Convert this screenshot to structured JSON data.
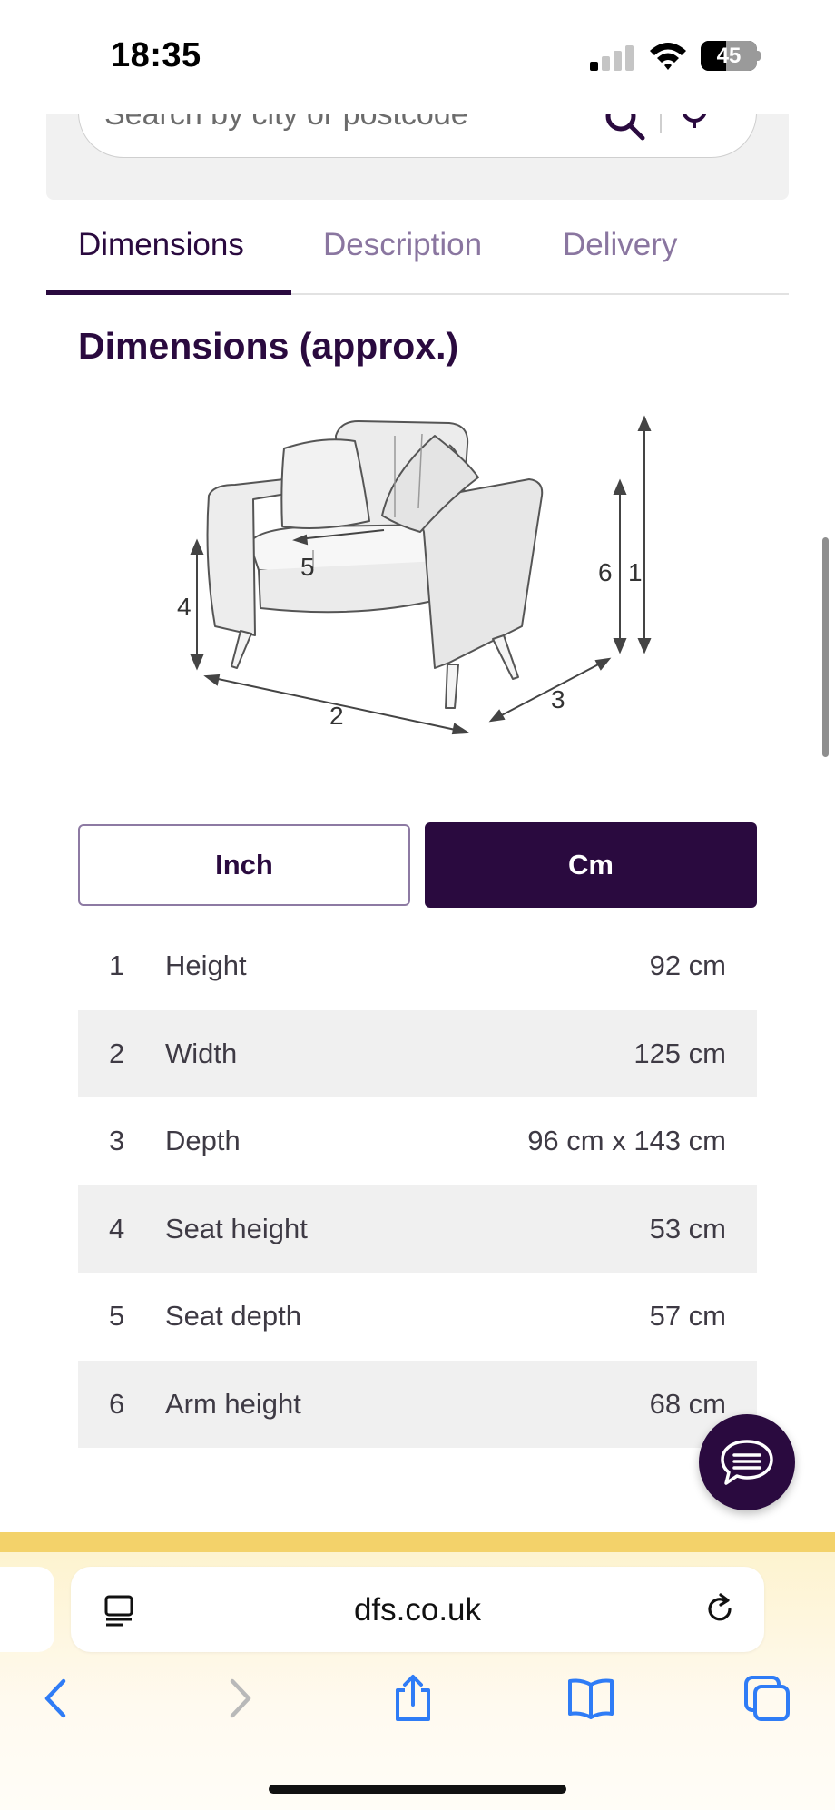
{
  "status_bar": {
    "time": "18:35",
    "battery_level": "45"
  },
  "search": {
    "placeholder": "Search by city or postcode"
  },
  "tabs": [
    {
      "label": "Dimensions",
      "active": true
    },
    {
      "label": "Description",
      "active": false
    },
    {
      "label": "Delivery",
      "active": false
    }
  ],
  "section_title": "Dimensions (approx.)",
  "diagram": {
    "labels": [
      "1",
      "2",
      "3",
      "4",
      "5",
      "6"
    ]
  },
  "unit_toggle": {
    "inch_label": "Inch",
    "cm_label": "Cm",
    "selected": "Cm"
  },
  "dimensions": [
    {
      "num": "1",
      "label": "Height",
      "value": "92 cm"
    },
    {
      "num": "2",
      "label": "Width",
      "value": "125 cm"
    },
    {
      "num": "3",
      "label": "Depth",
      "value": "96 cm x 143 cm"
    },
    {
      "num": "4",
      "label": "Seat height",
      "value": "53 cm"
    },
    {
      "num": "5",
      "label": "Seat depth",
      "value": "57 cm"
    },
    {
      "num": "6",
      "label": "Arm height",
      "value": "68 cm"
    }
  ],
  "browser": {
    "url": "dfs.co.uk"
  },
  "colors": {
    "brand_purple": "#2a0a3f",
    "tab_inactive": "#8a76a0",
    "promo_strip": "#f3d26a",
    "ios_blue": "#2f7cf6"
  }
}
